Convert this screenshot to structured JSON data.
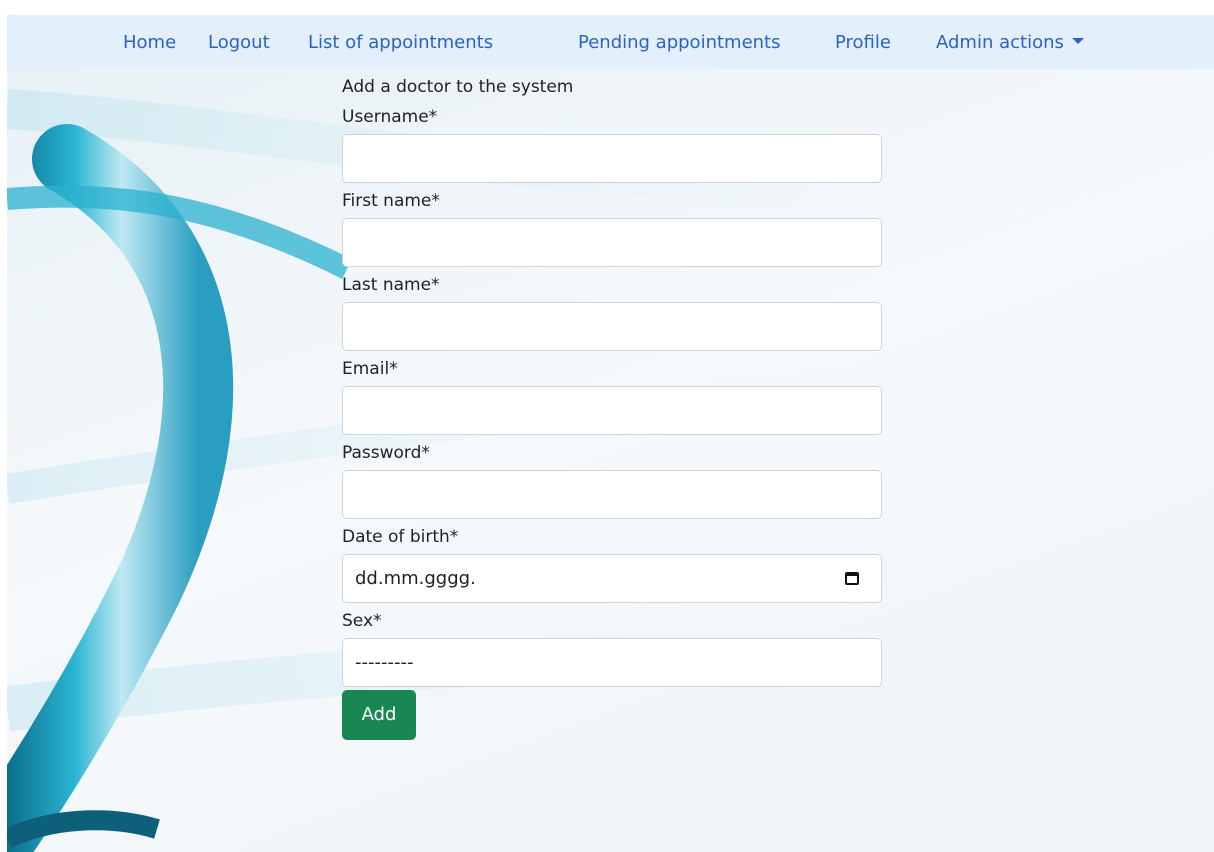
{
  "nav": {
    "home": "Home",
    "logout": "Logout",
    "appointments": "List of appointments",
    "pending": "Pending appointments",
    "profile": "Profile",
    "admin": "Admin actions"
  },
  "form": {
    "title": "Add a doctor to the system",
    "username_label": "Username*",
    "first_name_label": "First name*",
    "last_name_label": "Last name*",
    "email_label": "Email*",
    "password_label": "Password*",
    "dob_label": "Date of birth*",
    "dob_placeholder": "dd.mm.gggg.",
    "sex_label": "Sex*",
    "sex_selected": "---------",
    "submit_label": "Add"
  },
  "colors": {
    "nav_bg": "#e3f0fb",
    "link": "#2a62c9",
    "button": "#198754"
  }
}
